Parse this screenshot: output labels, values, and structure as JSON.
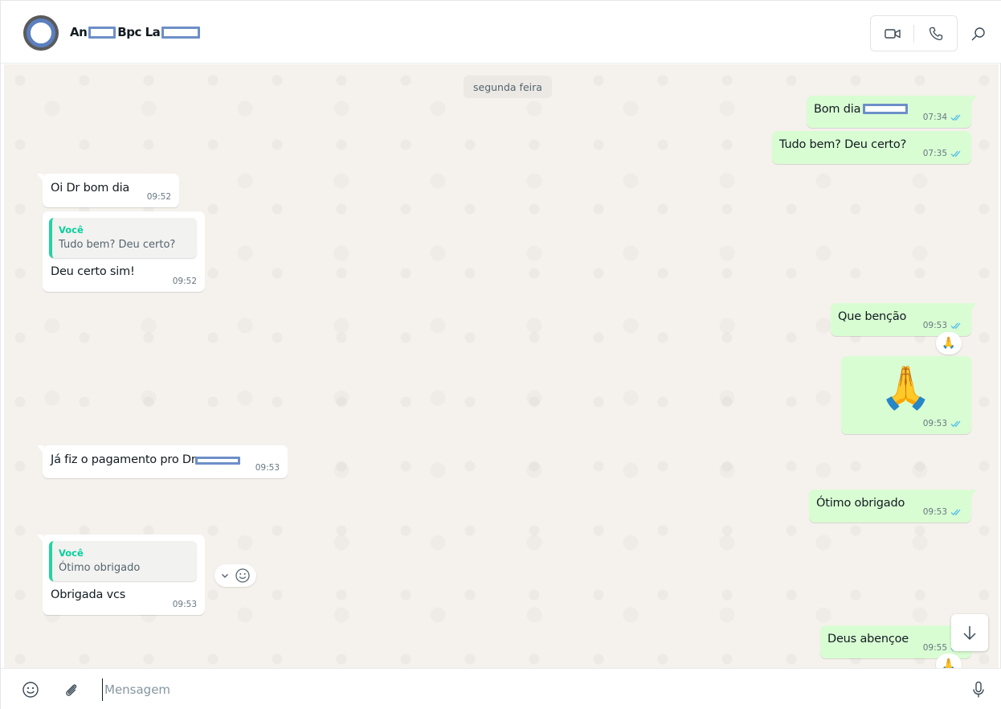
{
  "header": {
    "contact_name_a": "An",
    "contact_name_b": "Bpc La",
    "icons": {
      "video": "video-camera-icon",
      "phone": "phone-icon",
      "search": "search-icon"
    }
  },
  "chat": {
    "date_chip": "segunda feira",
    "messages": [
      {
        "direction": "out",
        "text": "Bom dia",
        "time": "07:34",
        "status": "read"
      },
      {
        "direction": "out",
        "text": "Tudo bem? Deu certo?",
        "time": "07:35",
        "status": "read"
      },
      {
        "direction": "in",
        "text": "Oi Dr bom dia",
        "time": "09:52"
      },
      {
        "direction": "in",
        "quote_author": "Você",
        "quote_text": "Tudo bem? Deu certo?",
        "text": "Deu certo sim!",
        "time": "09:52"
      },
      {
        "direction": "out",
        "text": "Que benção",
        "time": "09:53",
        "status": "read",
        "reaction": "🙏"
      },
      {
        "direction": "out",
        "emoji": "🙏",
        "time": "09:53",
        "status": "read"
      },
      {
        "direction": "in",
        "text": "Já fiz o pagamento pro Dr",
        "time": "09:53"
      },
      {
        "direction": "out",
        "text": "Ótimo obrigado",
        "time": "09:53",
        "status": "read"
      },
      {
        "direction": "in",
        "quote_author": "Você",
        "quote_text": "Ótimo obrigado",
        "text": "Obrigada vcs",
        "time": "09:53"
      },
      {
        "direction": "out",
        "text": "Deus abençoe",
        "time": "09:55",
        "status": "read",
        "reaction": "🙏"
      }
    ]
  },
  "composer": {
    "placeholder": "Mensagem",
    "icons": {
      "emoji": "emoji-icon",
      "attach": "paperclip-icon",
      "mic": "microphone-icon"
    }
  },
  "colors": {
    "outgoing_bubble": "#d9fdd3",
    "incoming_bubble": "#ffffff",
    "chat_background": "#f5f1ec",
    "read_tick": "#53bdeb",
    "quote_accent": "#06cf9c",
    "redaction": "#6d8fc8"
  }
}
